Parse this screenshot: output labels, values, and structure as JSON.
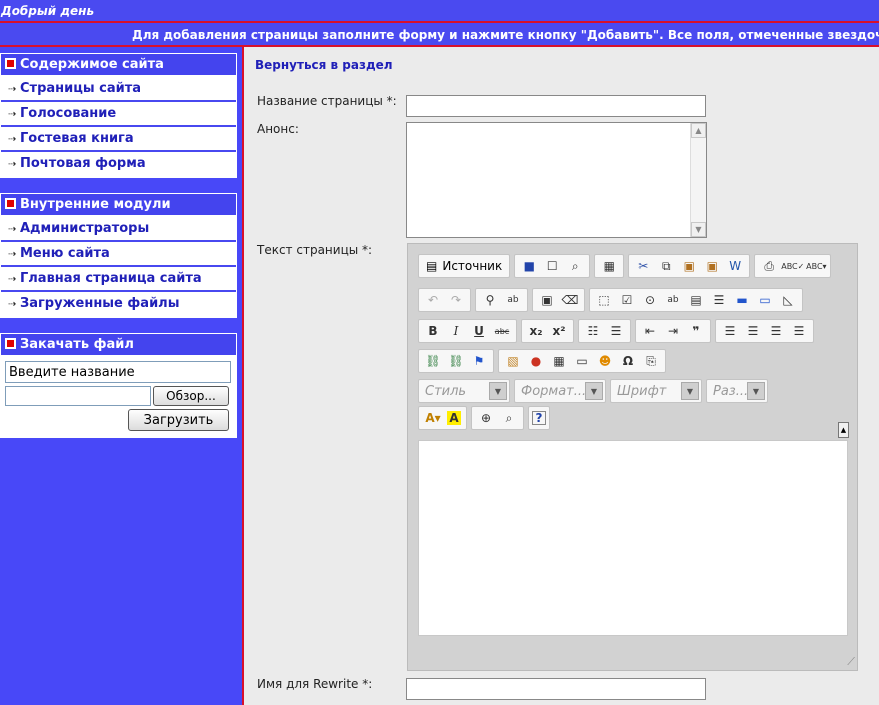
{
  "header": {
    "greeting": "Добрый день",
    "notice": "Для добавления страницы заполните форму и нажмите кнопку \"Добавить\". Все поля, отмеченные звездочкой"
  },
  "sidebar": {
    "site_content": {
      "title": "Содержимое сайта",
      "items": [
        "Страницы сайта",
        "Голосование",
        "Гостевая книга",
        "Почтовая форма"
      ]
    },
    "internal_modules": {
      "title": "Внутренние модули",
      "items": [
        "Администраторы",
        "Меню сайта",
        "Главная страница сайта",
        "Загруженные файлы"
      ]
    },
    "upload": {
      "title": "Закачать файл",
      "name_value": "Введите название",
      "browse_label": "Обзор...",
      "upload_label": "Загрузить"
    }
  },
  "main": {
    "back_link": "Вернуться в раздел",
    "page_name_label": "Название страницы *:",
    "announce_label": "Анонс:",
    "page_text_label": "Текст страницы *:",
    "rewrite_label": "Имя для Rewrite *:"
  },
  "editor": {
    "source_label": "Источник",
    "style_placeholder": "Стиль",
    "format_placeholder": "Формат...",
    "font_placeholder": "Шрифт",
    "size_placeholder": "Раз..."
  },
  "colors": {
    "sidebar_bg": "#4848f8",
    "header_bg": "#4a4af0",
    "accent_red": "#d8102c",
    "link_blue": "#2020b8",
    "main_bg": "#ebebeb"
  }
}
